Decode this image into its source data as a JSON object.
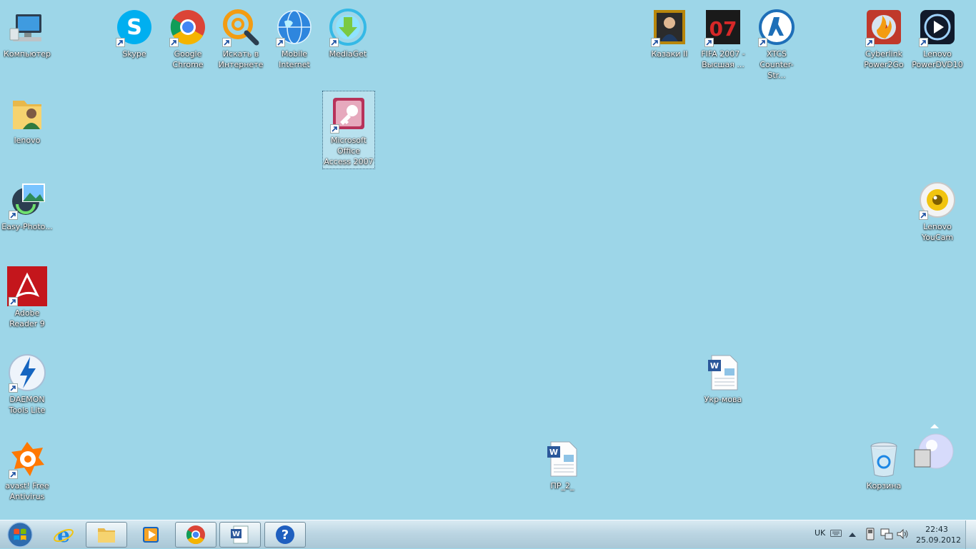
{
  "desktop_icons": [
    {
      "label": "Компьютер"
    },
    {
      "label": "Skype"
    },
    {
      "label": "Google Chrome"
    },
    {
      "label": "Искать в Интернете"
    },
    {
      "label": "Mobile Internet"
    },
    {
      "label": "MediaGet"
    },
    {
      "label": "Казаки II"
    },
    {
      "label": "FIFA 2007 - Высшая ..."
    },
    {
      "label": "XTCS Counter-Str..."
    },
    {
      "label": "Cyberlink Power2Go"
    },
    {
      "label": "Lenovo PowerDVD10"
    },
    {
      "label": "lenovo"
    },
    {
      "label": "Microsoft Office Access 2007"
    },
    {
      "label": "Easy-Photo..."
    },
    {
      "label": "Lenovo YouCam"
    },
    {
      "label": "Adobe Reader 9"
    },
    {
      "label": "DAEMON Tools Lite"
    },
    {
      "label": "Укр-мова"
    },
    {
      "label": "avast! Free Antivirus"
    },
    {
      "label": "ПР_2_"
    },
    {
      "label": "Корзина"
    }
  ],
  "fifa_badge": "07",
  "taskbar": {
    "language": "UK",
    "time": "22:43",
    "date": "25.09.2012"
  },
  "colors": {
    "desktop_background": "#9dd6e8",
    "label_text": "#ffffff",
    "taskbar": "#bcd6e3"
  }
}
